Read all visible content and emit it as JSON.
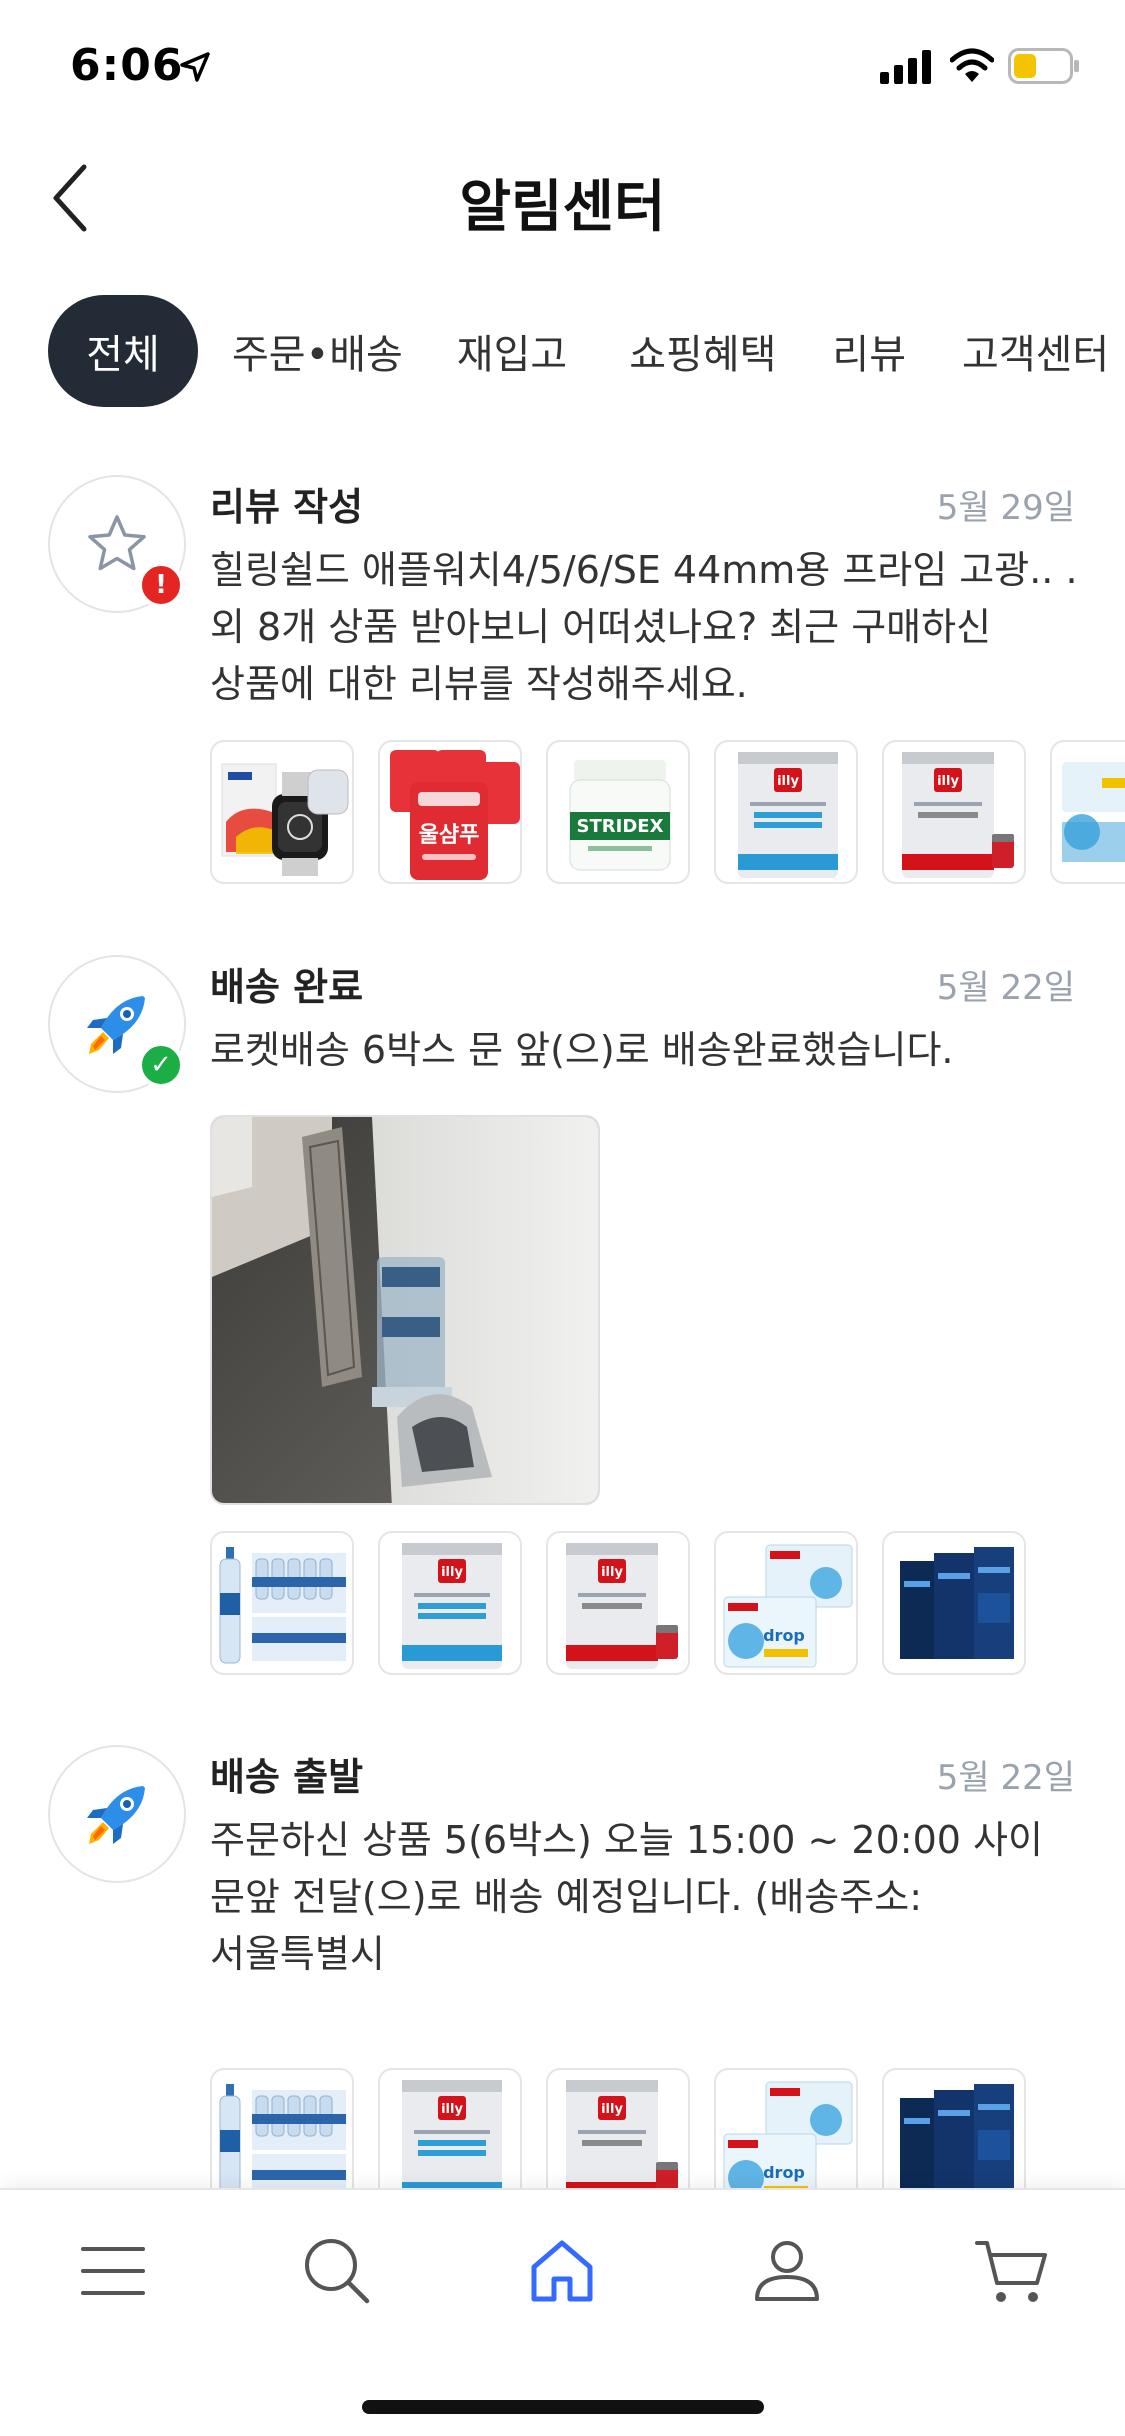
{
  "status_bar": {
    "time": "6:06"
  },
  "header": {
    "title": "알림센터"
  },
  "tabs": [
    {
      "label": "전체",
      "active": true
    },
    {
      "label": "주문•배송",
      "active": false
    },
    {
      "label": "재입고",
      "active": false
    },
    {
      "label": "쇼핑혜택",
      "active": false
    },
    {
      "label": "리뷰",
      "active": false
    },
    {
      "label": "고객센터",
      "active": false
    }
  ],
  "notifications": [
    {
      "icon": "star-icon",
      "badge": "!",
      "badge_color": "#e52521",
      "title": "리뷰 작성",
      "date": "5월 29일",
      "body": "힐링쉴드 애플워치4/5/6/SE 44mm용 프라임 고광.. . 외 8개 상품 받아보니 어떠셨나요? 최근 구매하신 상품에 대한 리뷰를 작성해주세요.",
      "thumbs": [
        {
          "name": "watch-screen-protector"
        },
        {
          "name": "shampoo-packs",
          "text": "울샴푸"
        },
        {
          "name": "stridex-pads",
          "text": "STRIDEX"
        },
        {
          "name": "illy-decaf-can",
          "text": "illy"
        },
        {
          "name": "illy-classico-can",
          "text": "illy"
        },
        {
          "name": "drop-cleaner"
        }
      ]
    },
    {
      "icon": "rocket-icon",
      "badge": "✓",
      "badge_color": "#1aae45",
      "title": "배송 완료",
      "date": "5월 22일",
      "body": "로켓배송 6박스 문 앞(으)로 배송완료했습니다.",
      "thumbs": [
        {
          "name": "water-bottles"
        },
        {
          "name": "illy-decaf-can",
          "text": "illy"
        },
        {
          "name": "illy-classico-can",
          "text": "illy"
        },
        {
          "name": "drop-cleaner",
          "text": "drop"
        },
        {
          "name": "blue-boxes"
        }
      ]
    },
    {
      "icon": "rocket-icon",
      "title": "배송 출발",
      "date": "5월 22일",
      "body": "주문하신 상품 5(6박스) 오늘 15:00 ~ 20:00 사이 문앞 전달(으)로 배송 예정입니다. (배송주소: 서울특별시",
      "thumbs": [
        {
          "name": "water-bottles"
        },
        {
          "name": "illy-decaf-can",
          "text": "illy"
        },
        {
          "name": "illy-classico-can",
          "text": "illy"
        },
        {
          "name": "drop-cleaner",
          "text": "drop"
        },
        {
          "name": "blue-boxes"
        }
      ]
    }
  ],
  "bottom_nav": [
    {
      "icon": "menu-icon"
    },
    {
      "icon": "search-icon"
    },
    {
      "icon": "home-icon",
      "active": true,
      "color": "#346aff"
    },
    {
      "icon": "user-icon"
    },
    {
      "icon": "cart-icon"
    }
  ]
}
